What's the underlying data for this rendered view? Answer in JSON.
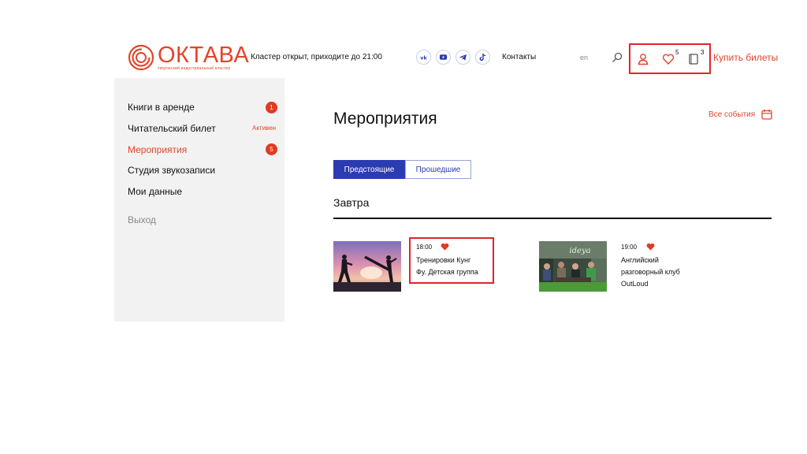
{
  "header": {
    "logo_name": "ОКТАВА",
    "logo_sub": "творческий индустриальный кластер",
    "status": "Кластер открыт, приходите до 21:00",
    "socials": [
      "vk-icon",
      "youtube-icon",
      "telegram-icon",
      "tiktok-icon"
    ],
    "contacts": "Контакты",
    "lang": "en",
    "favorites_count": "5",
    "books_count": "3",
    "buy_tickets": "Купить билеты"
  },
  "sidebar": {
    "items": [
      {
        "label": "Книги в аренде",
        "badge": "1"
      },
      {
        "label": "Читательский билет",
        "status": "Активен"
      },
      {
        "label": "Мероприятия",
        "badge": "5",
        "active": true
      },
      {
        "label": "Студия звукозаписи"
      },
      {
        "label": "Мои данные"
      }
    ],
    "exit": "Выход"
  },
  "main": {
    "title": "Мероприятия",
    "all_events": "Все события",
    "tabs": [
      {
        "label": "Предстоящие",
        "active": true
      },
      {
        "label": "Прошедшие",
        "active": false
      }
    ],
    "section": "Завтра",
    "events": [
      {
        "time": "18:00",
        "title_line1": "Тренировки Кунг",
        "title_line2": "Фу. Детская группа",
        "liked": true
      },
      {
        "time": "19:00",
        "title_line1": "Английский",
        "title_line2": "разговорный клуб",
        "title_line3": "OutLoud",
        "liked": true
      }
    ]
  },
  "colors": {
    "accent": "#e2452b",
    "primary_blue": "#2b3bb0",
    "highlight_red": "#e0242a",
    "sidebar_bg": "#f2f2f2"
  }
}
